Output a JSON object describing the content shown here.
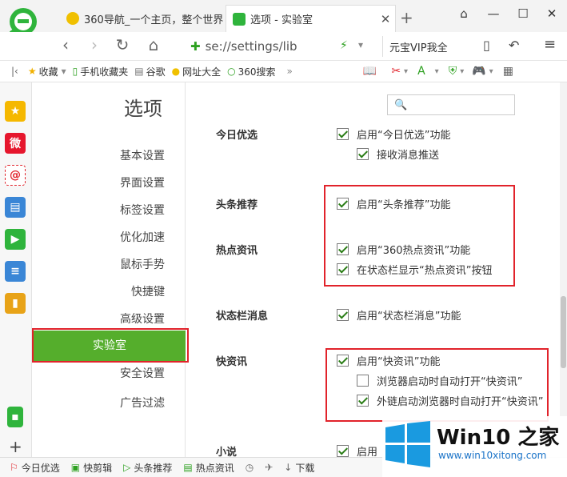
{
  "browser": {
    "tabs": [
      {
        "title": "360导航_一个主页，整个世界",
        "close": ""
      },
      {
        "title": "选项 - 实验室",
        "close": "✕"
      }
    ],
    "new_tab": "+",
    "window_controls": [
      "⌂",
      "—",
      "☐",
      "✕"
    ],
    "url": "se://settings/lib",
    "search_box": "元宝VIP我全"
  },
  "bookmarks": [
    "收藏",
    "手机收藏夹",
    "谷歌",
    "网址大全",
    "360搜索"
  ],
  "settings": {
    "title": "选项",
    "nav": [
      "基本设置",
      "界面设置",
      "标签设置",
      "优化加速",
      "鼠标手势",
      "快捷键",
      "高级设置",
      "实验室",
      "安全设置",
      "广告过滤"
    ],
    "active": "实验室"
  },
  "sections": {
    "today": {
      "label": "今日优选",
      "opts": [
        "启用“今日优选”功能",
        "接收消息推送"
      ]
    },
    "toutiao": {
      "label": "头条推荐",
      "opts": [
        "启用“头条推荐”功能"
      ]
    },
    "hot": {
      "label": "热点资讯",
      "opts": [
        "启用“360热点资讯”功能",
        "在状态栏显示“热点资讯”按钮"
      ]
    },
    "status": {
      "label": "状态栏消息",
      "opts": [
        "启用“状态栏消息”功能"
      ]
    },
    "kuai": {
      "label": "快资讯",
      "opts": [
        "启用“快资讯”功能",
        "浏览器启动时自动打开“快资讯”",
        "外链启动浏览器时自动打开“快资讯”"
      ]
    },
    "xiaoshuo": {
      "label": "小说",
      "opts": [
        "启用"
      ]
    }
  },
  "statusbar": [
    "今日优选",
    "快剪辑",
    "头条推荐",
    "热点资讯",
    "下载"
  ],
  "watermark": {
    "title": "Win10 之家",
    "url": "www.win10xitong.com"
  },
  "colors": {
    "accent": "#55ae2c",
    "highlight": "#e1232b"
  }
}
